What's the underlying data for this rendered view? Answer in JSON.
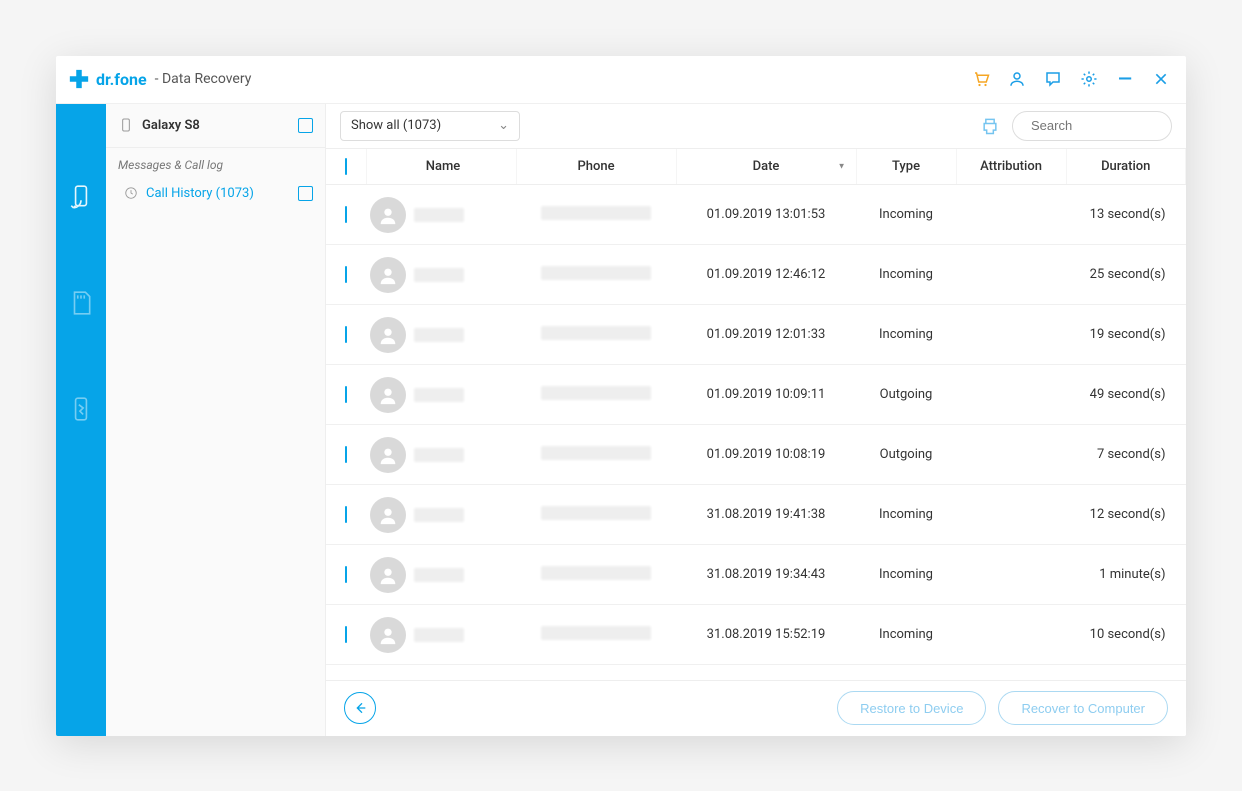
{
  "header": {
    "brand": "dr.fone",
    "subtitle": "- Data Recovery"
  },
  "sidebar": {
    "device": "Galaxy S8",
    "group": "Messages & Call log",
    "items": [
      {
        "label": "Call History (1073)"
      }
    ]
  },
  "toolbar": {
    "filter": "Show all (1073)",
    "search_placeholder": "Search"
  },
  "table": {
    "columns": {
      "name": "Name",
      "phone": "Phone",
      "date": "Date",
      "type": "Type",
      "attribution": "Attribution",
      "duration": "Duration"
    },
    "rows": [
      {
        "date": "01.09.2019 13:01:53",
        "type": "Incoming",
        "attribution": "",
        "duration": "13 second(s)"
      },
      {
        "date": "01.09.2019 12:46:12",
        "type": "Incoming",
        "attribution": "",
        "duration": "25 second(s)"
      },
      {
        "date": "01.09.2019 12:01:33",
        "type": "Incoming",
        "attribution": "",
        "duration": "19 second(s)"
      },
      {
        "date": "01.09.2019 10:09:11",
        "type": "Outgoing",
        "attribution": "",
        "duration": "49 second(s)"
      },
      {
        "date": "01.09.2019 10:08:19",
        "type": "Outgoing",
        "attribution": "",
        "duration": "7 second(s)"
      },
      {
        "date": "31.08.2019 19:41:38",
        "type": "Incoming",
        "attribution": "",
        "duration": "12 second(s)"
      },
      {
        "date": "31.08.2019 19:34:43",
        "type": "Incoming",
        "attribution": "",
        "duration": "1 minute(s)"
      },
      {
        "date": "31.08.2019 15:52:19",
        "type": "Incoming",
        "attribution": "",
        "duration": "10 second(s)"
      }
    ]
  },
  "footer": {
    "restore": "Restore to Device",
    "recover": "Recover to Computer"
  }
}
